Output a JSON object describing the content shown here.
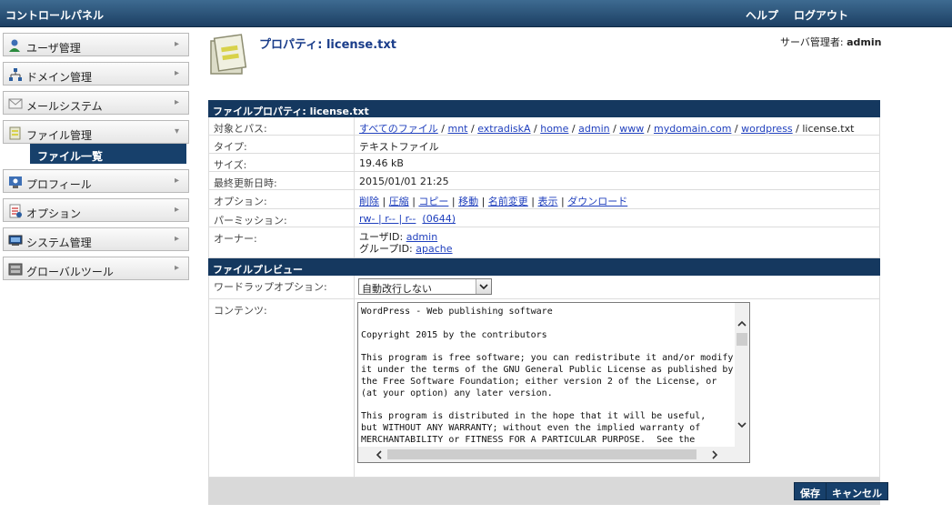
{
  "app": {
    "title": "コントロールパネル",
    "help": "ヘルプ",
    "logout": "ログアウト"
  },
  "sidebar": {
    "items": [
      {
        "label": "ユーザ管理",
        "icon": "user-icon"
      },
      {
        "label": "ドメイン管理",
        "icon": "domain-icon"
      },
      {
        "label": "メールシステム",
        "icon": "mail-icon"
      },
      {
        "label": "ファイル管理",
        "icon": "folder-icon"
      },
      {
        "label": "プロフィール",
        "icon": "profile-icon"
      },
      {
        "label": "オプション",
        "icon": "option-icon"
      },
      {
        "label": "システム管理",
        "icon": "system-icon"
      },
      {
        "label": "グローバルツール",
        "icon": "tools-icon"
      }
    ],
    "sub_item": "ファイル一覧"
  },
  "header": {
    "title": "プロパティ: license.txt",
    "admin_prefix": "サーバ管理者: ",
    "admin_name": "admin"
  },
  "properties": {
    "section_title": "ファイルプロパティ: license.txt",
    "path_label": "対象とパス:",
    "path_segments": [
      "すべてのファイル",
      "mnt",
      "extradiskA",
      "home",
      "admin",
      "www",
      "mydomain.com",
      "wordpress"
    ],
    "path_file": "license.txt",
    "type_label": "タイプ:",
    "type_value": "テキストファイル",
    "size_label": "サイズ:",
    "size_value": "19.46  kB",
    "modified_label": "最終更新日時:",
    "modified_value": "2015/01/01 21:25",
    "options_label": "オプション:",
    "options": [
      "削除",
      "圧縮",
      "コピー",
      "移動",
      "名前変更",
      "表示",
      "ダウンロード"
    ],
    "permission_label": "パーミッション:",
    "permission_value": "rw- | r-- | r--",
    "permission_octal": "(0644)",
    "owner_label": "オーナー:",
    "owner_user_prefix": "ユーザID: ",
    "owner_user": "admin",
    "owner_group_prefix": "グループID: ",
    "owner_group": "apache"
  },
  "preview": {
    "section_title": "ファイルプレビュー",
    "wrap_label": "ワードラップオプション:",
    "wrap_selected": "自動改行しない",
    "content_label": "コンテンツ:",
    "content_text": "WordPress - Web publishing software\n\nCopyright 2015 by the contributors\n\nThis program is free software; you can redistribute it and/or modify\nit under the terms of the GNU General Public License as published by\nthe Free Software Foundation; either version 2 of the License, or\n(at your option) any later version.\n\nThis program is distributed in the hope that it will be useful,\nbut WITHOUT ANY WARRANTY; without even the implied warranty of\nMERCHANTABILITY or FITNESS FOR A PARTICULAR PURPOSE.  See the"
  },
  "buttons": {
    "save": "保存",
    "cancel": "キャンセル"
  },
  "colors": {
    "header_bg": "#15385f",
    "link": "#1f3fbd",
    "title": "#1a3d8a"
  }
}
